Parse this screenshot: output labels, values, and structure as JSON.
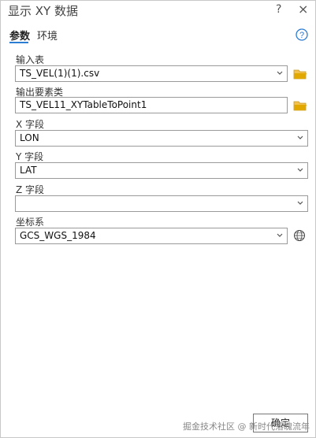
{
  "window": {
    "title": "显示 XY 数据",
    "help_glyph": "?",
    "close_glyph": "×"
  },
  "tabs": [
    {
      "label": "参数",
      "active": true
    },
    {
      "label": "环境",
      "active": false
    }
  ],
  "help_icon_glyph": "?",
  "params": {
    "input_table": {
      "label": "输入表",
      "value": "TS_VEL(1)(1).csv"
    },
    "output_features": {
      "label": "输出要素类",
      "value": "TS_VEL11_XYTableToPoint1"
    },
    "x_field": {
      "label": "X 字段",
      "value": "LON"
    },
    "y_field": {
      "label": "Y 字段",
      "value": "LAT"
    },
    "z_field": {
      "label": "Z 字段",
      "value": ""
    },
    "coord_system": {
      "label": "坐标系",
      "value": "GCS_WGS_1984"
    }
  },
  "footer": {
    "ok_label": "确定",
    "watermark": "掘金技术社区 @ 新时代落魄流年"
  },
  "colors": {
    "accent": "#2b7cd3",
    "folder": "#e0a800"
  }
}
